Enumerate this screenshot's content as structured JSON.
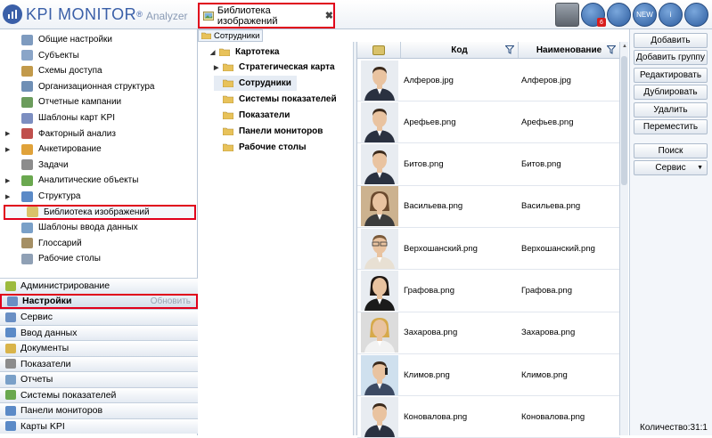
{
  "app": {
    "logo_main": "KPI MONITOR",
    "logo_reg": "®",
    "logo_sub": "Analyzer",
    "active_tab": "Библиотека изображений",
    "tab_close": "✖",
    "top_icons": [
      {
        "name": "user-icon",
        "label": ""
      },
      {
        "name": "messages-icon",
        "label": "",
        "badge": "6"
      },
      {
        "name": "documents-icon",
        "label": ""
      },
      {
        "name": "new-icon",
        "label": "NEW"
      },
      {
        "name": "info-icon",
        "label": "i"
      },
      {
        "name": "power-icon",
        "label": ""
      }
    ]
  },
  "settings_menu": [
    {
      "label": "Общие настройки",
      "icon": "settings-icon",
      "color": "#7e9bbf",
      "expandable": false
    },
    {
      "label": "Субъекты",
      "icon": "subjects-icon",
      "color": "#8aa5c8",
      "expandable": false
    },
    {
      "label": "Схемы доступа",
      "icon": "access-icon",
      "color": "#c29a4b",
      "expandable": false
    },
    {
      "label": "Организационная структура",
      "icon": "org-icon",
      "color": "#6f8fb5",
      "expandable": false
    },
    {
      "label": "Отчетные кампании",
      "icon": "campaign-icon",
      "color": "#6b9c5c",
      "expandable": false
    },
    {
      "label": "Шаблоны карт KPI",
      "icon": "kpi-template-icon",
      "color": "#7c8ec0",
      "expandable": false
    },
    {
      "label": "Факторный анализ",
      "icon": "factor-icon",
      "color": "#c0504d",
      "expandable": true
    },
    {
      "label": "Анкетирование",
      "icon": "survey-icon",
      "color": "#e0a23a",
      "expandable": true
    },
    {
      "label": "Задачи",
      "icon": "tasks-icon",
      "color": "#8c8c8c",
      "expandable": false
    },
    {
      "label": "Аналитические объекты",
      "icon": "analytic-icon",
      "color": "#6aa84f",
      "expandable": true
    },
    {
      "label": "Структура",
      "icon": "structure-icon",
      "color": "#5b8ac7",
      "expandable": true
    },
    {
      "label": "Библиотека изображений",
      "icon": "image-library-icon",
      "color": "#d9c26a",
      "expandable": false,
      "selected": true
    },
    {
      "label": "Шаблоны ввода данных",
      "icon": "input-template-icon",
      "color": "#7aa0c8",
      "expandable": false
    },
    {
      "label": "Глоссарий",
      "icon": "glossary-icon",
      "color": "#a58f64",
      "expandable": false
    },
    {
      "label": "Рабочие столы",
      "icon": "desktop-icon",
      "color": "#8fa0b5",
      "expandable": false
    }
  ],
  "accordion": [
    {
      "label": "Администрирование",
      "icon": "admin-icon",
      "color": "#9cba3d"
    },
    {
      "label": "Настройки",
      "icon": "settings-gear-icon",
      "color": "#6a8fc4",
      "active": true,
      "action": "Обновить"
    },
    {
      "label": "Сервис",
      "icon": "service-icon",
      "color": "#6a8fc4"
    },
    {
      "label": "Ввод данных",
      "icon": "data-input-icon",
      "color": "#5b8ac7"
    },
    {
      "label": "Документы",
      "icon": "documents-icon",
      "color": "#d9b44a"
    },
    {
      "label": "Показатели",
      "icon": "indicators-icon",
      "color": "#8c8c8c"
    },
    {
      "label": "Отчеты",
      "icon": "reports-icon",
      "color": "#7aa0c8"
    },
    {
      "label": "Системы показателей",
      "icon": "indicator-systems-icon",
      "color": "#6aa84f"
    },
    {
      "label": "Панели мониторов",
      "icon": "monitor-panels-icon",
      "color": "#5b8ac7"
    },
    {
      "label": "Карты KPI",
      "icon": "kpi-cards-icon",
      "color": "#5b8ac7"
    }
  ],
  "tree": {
    "breadcrumb": "Сотрудники",
    "root": "Картотека",
    "items": [
      {
        "label": "Стратегическая карта",
        "expandable": true
      },
      {
        "label": "Сотрудники",
        "expandable": false,
        "selected": true
      },
      {
        "label": "Системы показателей",
        "expandable": false
      },
      {
        "label": "Показатели",
        "expandable": false
      },
      {
        "label": "Панели мониторов",
        "expandable": false
      },
      {
        "label": "Рабочие столы",
        "expandable": false
      }
    ]
  },
  "grid": {
    "col_code": "Код",
    "col_name": "Наименование",
    "rows": [
      {
        "code": "Алферов.jpg",
        "name": "Алферов.jpg",
        "avatar": "male-suit"
      },
      {
        "code": "Арефьев.png",
        "name": "Арефьев.png",
        "avatar": "male-suit"
      },
      {
        "code": "Битов.png",
        "name": "Битов.png",
        "avatar": "male-suit"
      },
      {
        "code": "Васильева.png",
        "name": "Васильева.png",
        "avatar": "female"
      },
      {
        "code": "Верхошанский.png",
        "name": "Верхошанский.png",
        "avatar": "male-glasses"
      },
      {
        "code": "Графова.png",
        "name": "Графова.png",
        "avatar": "female-dark"
      },
      {
        "code": "Захарова.png",
        "name": "Захарова.png",
        "avatar": "female-blonde"
      },
      {
        "code": "Климов.png",
        "name": "Климов.png",
        "avatar": "male-phone"
      },
      {
        "code": "Коновалова.png",
        "name": "Коновалова.png",
        "avatar": "male-suit"
      }
    ]
  },
  "buttons": {
    "add": "Добавить",
    "add_group": "Добавить группу",
    "edit": "Редактировать",
    "duplicate": "Дублировать",
    "delete": "Удалить",
    "move": "Переместить",
    "search": "Поиск",
    "service": "Сервис"
  },
  "count": "Количество:31:1"
}
